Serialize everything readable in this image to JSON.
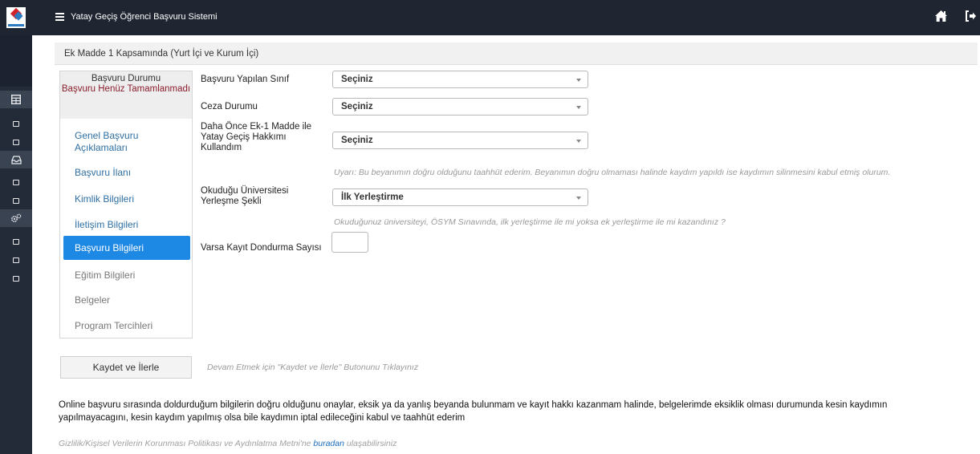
{
  "topbar": {
    "title": "Yatay Geçiş Öğrenci Başvuru Sistemi",
    "icons": [
      "menu-icon",
      "home-icon",
      "logout-icon"
    ]
  },
  "sidebar_rail": {
    "icons": [
      "table-icon",
      "square-icon",
      "square-icon",
      "inbox-icon",
      "square-icon",
      "square-icon",
      "cogs-icon",
      "square-icon",
      "square-icon",
      "square-icon"
    ]
  },
  "page": {
    "header": "Ek Madde 1 Kapsamında (Yurt İçi ve Kurum İçi)"
  },
  "status": {
    "title": "Başvuru Durumu",
    "value": "Başvuru Henüz Tamamlanmadı"
  },
  "nav": {
    "items": [
      {
        "label": "Genel Başvuru Açıklamaları"
      },
      {
        "label": "Başvuru İlanı"
      },
      {
        "label": "Kimlik Bilgileri"
      },
      {
        "label": "İletişim Bilgileri"
      },
      {
        "label": "Başvuru Bilgileri"
      },
      {
        "label": "Eğitim Bilgileri"
      },
      {
        "label": "Belgeler"
      },
      {
        "label": "Program Tercihleri"
      }
    ],
    "active_index": 4
  },
  "form": {
    "class_label": "Başvuru Yapılan Sınıf",
    "class_value": "Seçiniz",
    "penalty_label": "Ceza Durumu",
    "penalty_value": "Seçiniz",
    "ek1_label": "Daha Önce Ek-1 Madde ile Yatay Geçiş Hakkımı Kullandım",
    "ek1_value": "Seçiniz",
    "ek1_warning": "Uyarı: Bu beyanımın doğru olduğunu taahhüt ederim. Beyanımın doğru olmaması halinde kaydım yapıldı ise kaydımın silinmesini kabul etmiş olurum.",
    "placement_label": "Okuduğu Üniversitesi Yerleşme Şekli",
    "placement_value": "İlk Yerleştirme",
    "placement_hint": "Okuduğunuz üniversiteyi, ÖSYM Sınavında, ilk yerleştirme ile mi yoksa ek yerleştirme ile mi kazandınız ?",
    "freeze_label": "Varsa Kayıt Dondurma Sayısı",
    "freeze_value": ""
  },
  "actions": {
    "save_label": "Kaydet ve İlerle",
    "save_hint": "Devam Etmek için \"Kaydet ve İlerle\" Butonunu Tıklayınız"
  },
  "footer": {
    "disclaimer": "Online başvuru sırasında doldurduğum bilgilerin doğru olduğunu onaylar, eksik ya da yanlış beyanda bulunmam ve kayıt hakkı kazanmam halinde, belgelerimde eksiklik olması durumunda kesin kaydımın yapılmayacagını, kesin kaydım yapılmış olsa bile kaydımın iptal edileceğini kabul ve taahhüt ederim",
    "privacy_before": "Gizlilik/Kişisel Verilerin Korunması Politikası ve Aydınlatma Metni'ne ",
    "privacy_link": "buradan",
    "privacy_after": " ulaşabilirsiniz"
  },
  "colors": {
    "topbar": "#1f2632",
    "rail": "#232b38",
    "active_nav": "#1e88e5",
    "status_red": "#8b1e2d",
    "link_blue": "#2f6fa3"
  }
}
